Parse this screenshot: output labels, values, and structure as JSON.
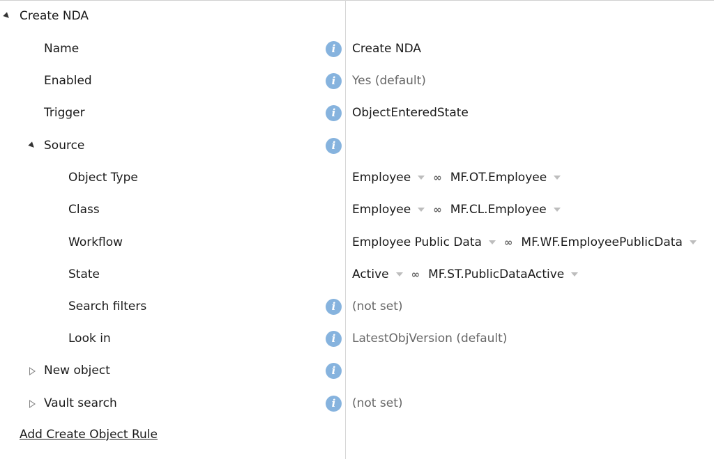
{
  "tree": {
    "root_label": "Create NDA",
    "name_label": "Name",
    "name_value": "Create NDA",
    "enabled_label": "Enabled",
    "enabled_value": "Yes (default)",
    "trigger_label": "Trigger",
    "trigger_value": "ObjectEnteredState",
    "source_label": "Source",
    "object_type": {
      "label": "Object Type",
      "value": "Employee",
      "alias": "MF.OT.Employee"
    },
    "class": {
      "label": "Class",
      "value": "Employee",
      "alias": "MF.CL.Employee"
    },
    "workflow": {
      "label": "Workflow",
      "value": "Employee Public Data",
      "alias": "MF.WF.EmployeePublicData"
    },
    "state": {
      "label": "State",
      "value": "Active",
      "alias": "MF.ST.PublicDataActive"
    },
    "search_filters": {
      "label": "Search filters",
      "value": "(not set)"
    },
    "look_in": {
      "label": "Look in",
      "value": "LatestObjVersion (default)"
    },
    "new_object_label": "New object",
    "vault_search": {
      "label": "Vault search",
      "value": "(not set)"
    }
  },
  "actions": {
    "add_rule": "Add Create Object Rule"
  },
  "icons": {
    "info": "info-icon",
    "link": "link-icon",
    "expand": "triangle-expanded-icon",
    "collapse": "triangle-collapsed-icon"
  },
  "colors": {
    "info_icon": "#86b3de",
    "muted_text": "#666666",
    "divider": "#d8d8d8"
  }
}
